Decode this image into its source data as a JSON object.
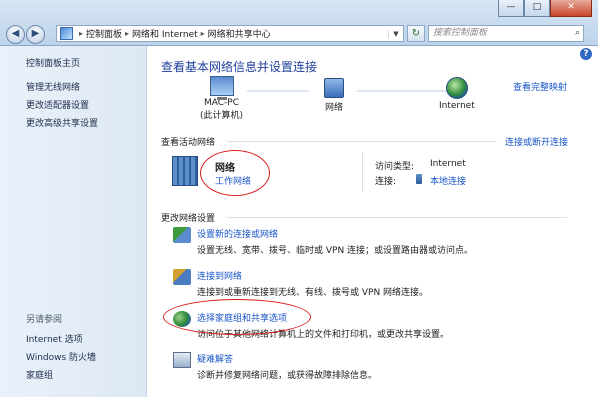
{
  "window": {
    "controls": {
      "minimize": "—",
      "maximize": "□",
      "close": "✕"
    }
  },
  "toolbar": {
    "back_glyph": "◀",
    "forward_glyph": "▶",
    "breadcrumbs": [
      "控制面板",
      "网络和 Internet",
      "网络和共享中心"
    ],
    "search_placeholder": "搜索控制面板",
    "icons": [
      "back-icon",
      "forward-icon",
      "control-panel-icon",
      "refresh-icon",
      "search-icon"
    ]
  },
  "sidebar": {
    "top_links": [
      "控制面板主页",
      "管理无线网络",
      "更改适配器设置",
      "更改高级共享设置"
    ],
    "see_also_title": "另请参阅",
    "see_also_links": [
      "Internet 选项",
      "Windows 防火墙",
      "家庭组"
    ]
  },
  "main": {
    "help": "?",
    "title": "查看基本网络信息并设置连接",
    "full_map_link": "查看完整映射",
    "map_nodes": [
      {
        "label": "MAC-PC",
        "sub": "(此计算机)",
        "icon": "computer-icon"
      },
      {
        "label": "网络",
        "sub": "",
        "icon": "network-icon"
      },
      {
        "label": "Internet",
        "sub": "",
        "icon": "globe-icon"
      }
    ],
    "active_networks_header": "查看活动网络",
    "connect_disconnect_link": "连接或断开连接",
    "network": {
      "name": "网络",
      "type": "工作网络",
      "access_type_label": "访问类型:",
      "access_type_value": "Internet",
      "connections_label": "连接:",
      "connections_value": "本地连接"
    },
    "change_settings_header": "更改网络设置",
    "tasks": [
      {
        "link": "设置新的连接或网络",
        "desc": "设置无线、宽带、拨号、临时或 VPN 连接；或设置路由器或访问点。",
        "icon": "new-connection-icon"
      },
      {
        "link": "连接到网络",
        "desc": "连接到或重新连接到无线、有线、拨号或 VPN 网络连接。",
        "icon": "connect-network-icon"
      },
      {
        "link": "选择家庭组和共享选项",
        "desc": "访问位于其他网络计算机上的文件和打印机，或更改共享设置。",
        "icon": "homegroup-icon"
      },
      {
        "link": "疑难解答",
        "desc": "诊断并修复网络问题，或获得故障排除信息。",
        "icon": "troubleshoot-icon"
      }
    ]
  },
  "annotations": {
    "highlight_color": "#d81e1e"
  }
}
